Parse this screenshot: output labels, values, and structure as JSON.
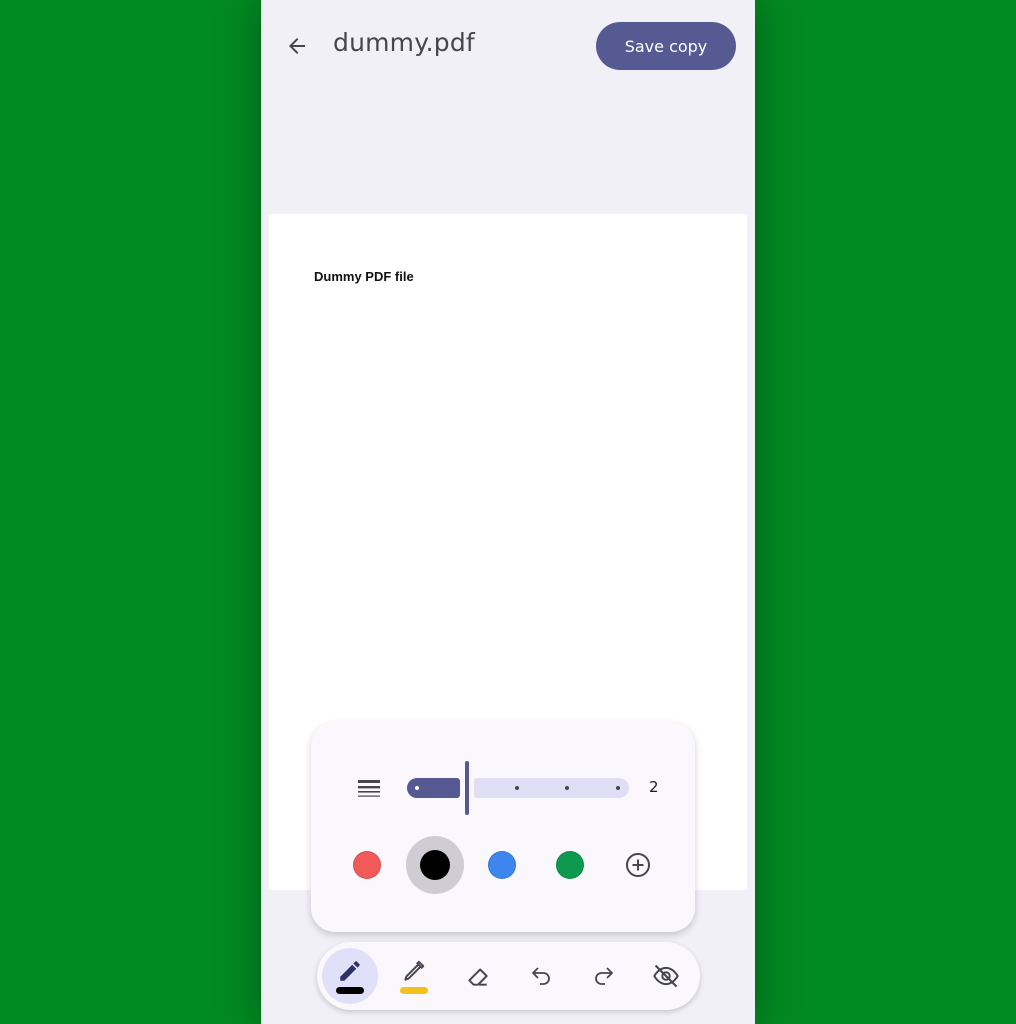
{
  "header": {
    "title": "dummy.pdf",
    "save_label": "Save copy",
    "back_icon": "arrow-back-icon"
  },
  "document": {
    "text": "Dummy PDF file"
  },
  "pen_panel": {
    "width_icon": "line-weight-icon",
    "stroke_width_value": "2",
    "colors": [
      "#f25a5a",
      "#000000",
      "#3d86ee",
      "#0d9a4f"
    ],
    "selected_color": "#000000",
    "add_color_icon": "add-circle-icon"
  },
  "toolbar": {
    "tools": [
      {
        "name": "pen",
        "icon": "pen-icon",
        "active": true,
        "indicator_color": "#000000"
      },
      {
        "name": "highlighter",
        "icon": "highlighter-icon",
        "active": false,
        "indicator_color": "#f1c21b"
      },
      {
        "name": "eraser",
        "icon": "eraser-icon",
        "active": false
      },
      {
        "name": "undo",
        "icon": "undo-icon",
        "active": false
      },
      {
        "name": "redo",
        "icon": "redo-icon",
        "active": false
      },
      {
        "name": "hide-annotations",
        "icon": "visibility-off-icon",
        "active": false
      }
    ]
  },
  "colors": {
    "primary": "#565a92",
    "surface": "#f1f0f7",
    "background": "#008a22"
  }
}
